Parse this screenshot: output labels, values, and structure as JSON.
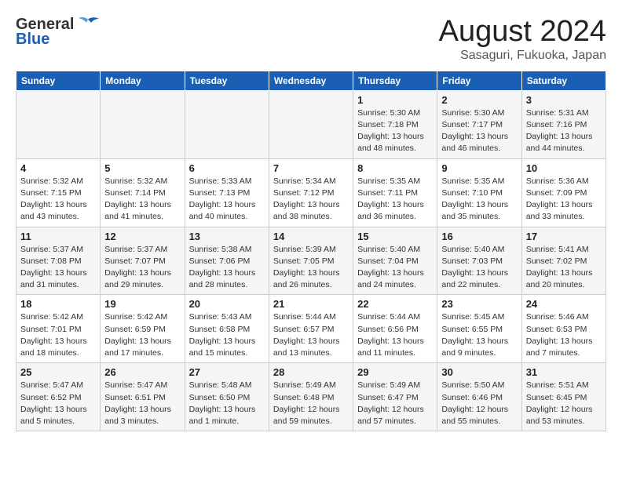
{
  "header": {
    "logo_general": "General",
    "logo_blue": "Blue",
    "month": "August 2024",
    "location": "Sasaguri, Fukuoka, Japan"
  },
  "days_of_week": [
    "Sunday",
    "Monday",
    "Tuesday",
    "Wednesday",
    "Thursday",
    "Friday",
    "Saturday"
  ],
  "weeks": [
    [
      {
        "num": "",
        "info": ""
      },
      {
        "num": "",
        "info": ""
      },
      {
        "num": "",
        "info": ""
      },
      {
        "num": "",
        "info": ""
      },
      {
        "num": "1",
        "info": "Sunrise: 5:30 AM\nSunset: 7:18 PM\nDaylight: 13 hours\nand 48 minutes."
      },
      {
        "num": "2",
        "info": "Sunrise: 5:30 AM\nSunset: 7:17 PM\nDaylight: 13 hours\nand 46 minutes."
      },
      {
        "num": "3",
        "info": "Sunrise: 5:31 AM\nSunset: 7:16 PM\nDaylight: 13 hours\nand 44 minutes."
      }
    ],
    [
      {
        "num": "4",
        "info": "Sunrise: 5:32 AM\nSunset: 7:15 PM\nDaylight: 13 hours\nand 43 minutes."
      },
      {
        "num": "5",
        "info": "Sunrise: 5:32 AM\nSunset: 7:14 PM\nDaylight: 13 hours\nand 41 minutes."
      },
      {
        "num": "6",
        "info": "Sunrise: 5:33 AM\nSunset: 7:13 PM\nDaylight: 13 hours\nand 40 minutes."
      },
      {
        "num": "7",
        "info": "Sunrise: 5:34 AM\nSunset: 7:12 PM\nDaylight: 13 hours\nand 38 minutes."
      },
      {
        "num": "8",
        "info": "Sunrise: 5:35 AM\nSunset: 7:11 PM\nDaylight: 13 hours\nand 36 minutes."
      },
      {
        "num": "9",
        "info": "Sunrise: 5:35 AM\nSunset: 7:10 PM\nDaylight: 13 hours\nand 35 minutes."
      },
      {
        "num": "10",
        "info": "Sunrise: 5:36 AM\nSunset: 7:09 PM\nDaylight: 13 hours\nand 33 minutes."
      }
    ],
    [
      {
        "num": "11",
        "info": "Sunrise: 5:37 AM\nSunset: 7:08 PM\nDaylight: 13 hours\nand 31 minutes."
      },
      {
        "num": "12",
        "info": "Sunrise: 5:37 AM\nSunset: 7:07 PM\nDaylight: 13 hours\nand 29 minutes."
      },
      {
        "num": "13",
        "info": "Sunrise: 5:38 AM\nSunset: 7:06 PM\nDaylight: 13 hours\nand 28 minutes."
      },
      {
        "num": "14",
        "info": "Sunrise: 5:39 AM\nSunset: 7:05 PM\nDaylight: 13 hours\nand 26 minutes."
      },
      {
        "num": "15",
        "info": "Sunrise: 5:40 AM\nSunset: 7:04 PM\nDaylight: 13 hours\nand 24 minutes."
      },
      {
        "num": "16",
        "info": "Sunrise: 5:40 AM\nSunset: 7:03 PM\nDaylight: 13 hours\nand 22 minutes."
      },
      {
        "num": "17",
        "info": "Sunrise: 5:41 AM\nSunset: 7:02 PM\nDaylight: 13 hours\nand 20 minutes."
      }
    ],
    [
      {
        "num": "18",
        "info": "Sunrise: 5:42 AM\nSunset: 7:01 PM\nDaylight: 13 hours\nand 18 minutes."
      },
      {
        "num": "19",
        "info": "Sunrise: 5:42 AM\nSunset: 6:59 PM\nDaylight: 13 hours\nand 17 minutes."
      },
      {
        "num": "20",
        "info": "Sunrise: 5:43 AM\nSunset: 6:58 PM\nDaylight: 13 hours\nand 15 minutes."
      },
      {
        "num": "21",
        "info": "Sunrise: 5:44 AM\nSunset: 6:57 PM\nDaylight: 13 hours\nand 13 minutes."
      },
      {
        "num": "22",
        "info": "Sunrise: 5:44 AM\nSunset: 6:56 PM\nDaylight: 13 hours\nand 11 minutes."
      },
      {
        "num": "23",
        "info": "Sunrise: 5:45 AM\nSunset: 6:55 PM\nDaylight: 13 hours\nand 9 minutes."
      },
      {
        "num": "24",
        "info": "Sunrise: 5:46 AM\nSunset: 6:53 PM\nDaylight: 13 hours\nand 7 minutes."
      }
    ],
    [
      {
        "num": "25",
        "info": "Sunrise: 5:47 AM\nSunset: 6:52 PM\nDaylight: 13 hours\nand 5 minutes."
      },
      {
        "num": "26",
        "info": "Sunrise: 5:47 AM\nSunset: 6:51 PM\nDaylight: 13 hours\nand 3 minutes."
      },
      {
        "num": "27",
        "info": "Sunrise: 5:48 AM\nSunset: 6:50 PM\nDaylight: 13 hours\nand 1 minute."
      },
      {
        "num": "28",
        "info": "Sunrise: 5:49 AM\nSunset: 6:48 PM\nDaylight: 12 hours\nand 59 minutes."
      },
      {
        "num": "29",
        "info": "Sunrise: 5:49 AM\nSunset: 6:47 PM\nDaylight: 12 hours\nand 57 minutes."
      },
      {
        "num": "30",
        "info": "Sunrise: 5:50 AM\nSunset: 6:46 PM\nDaylight: 12 hours\nand 55 minutes."
      },
      {
        "num": "31",
        "info": "Sunrise: 5:51 AM\nSunset: 6:45 PM\nDaylight: 12 hours\nand 53 minutes."
      }
    ]
  ]
}
